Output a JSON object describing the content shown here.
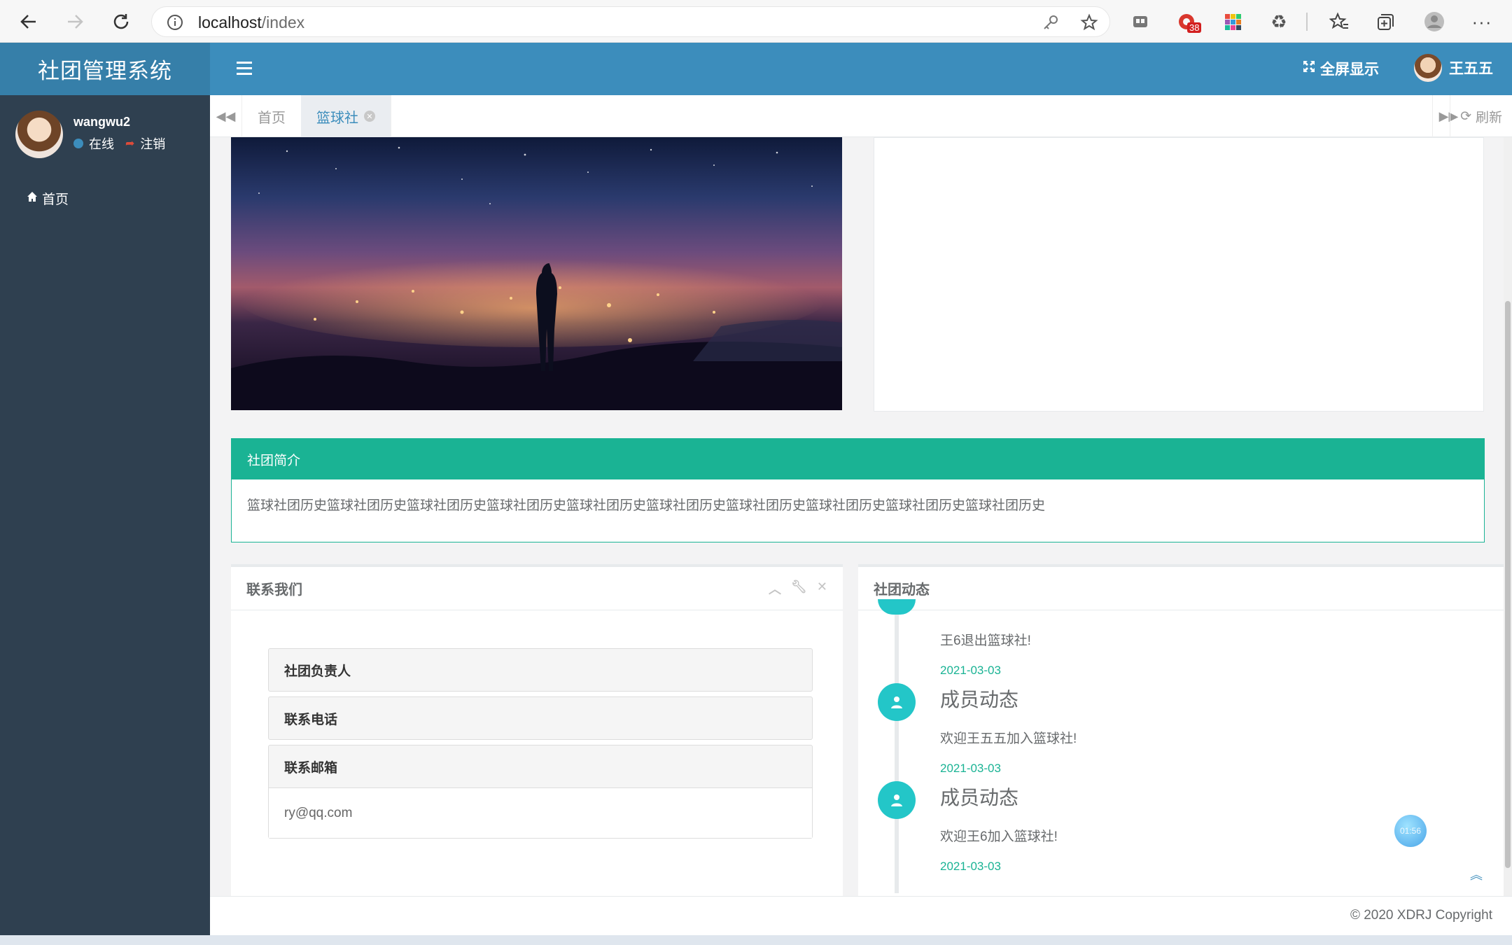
{
  "browser": {
    "url_host": "localhost",
    "url_path": "/index",
    "badge_count": "38"
  },
  "header": {
    "brand": "社团管理系统",
    "fullscreen_label": "全屏显示",
    "user_name": "王五五"
  },
  "sidebar": {
    "username": "wangwu2",
    "status_online": "在线",
    "status_logout": "注销",
    "items": [
      {
        "label": "首页",
        "icon": "home-icon"
      }
    ]
  },
  "tabs": {
    "items": [
      {
        "label": "首页",
        "active": false
      },
      {
        "label": "篮球社",
        "active": true
      }
    ],
    "refresh_label": "刷新"
  },
  "intro": {
    "title": "社团简介",
    "body": "篮球社团历史篮球社团历史篮球社团历史篮球社团历史篮球社团历史篮球社团历史篮球社团历史篮球社团历史篮球社团历史篮球社团历史"
  },
  "contact": {
    "title": "联系我们",
    "panels": [
      {
        "label": "社团负责人"
      },
      {
        "label": "联系电话"
      },
      {
        "label": "联系邮箱",
        "value": "ry@qq.com"
      }
    ]
  },
  "news": {
    "title": "社团动态",
    "partial_text": "王6退出篮球社!",
    "partial_date": "2021-03-03",
    "items": [
      {
        "title": "成员动态",
        "text": "欢迎王五五加入篮球社!",
        "date": "2021-03-03"
      },
      {
        "title": "成员动态",
        "text": "欢迎王6加入篮球社!",
        "date": "2021-03-03"
      }
    ],
    "bubble_text": "01:56"
  },
  "footer": {
    "copyright": "© 2020 XDRJ Copyright"
  },
  "colors": {
    "header": "#3c8dbc",
    "brand_bg": "#367fa9",
    "sidebar": "#2f4050",
    "accent_green": "#1ab394",
    "timeline_icon": "#23c6c8"
  }
}
